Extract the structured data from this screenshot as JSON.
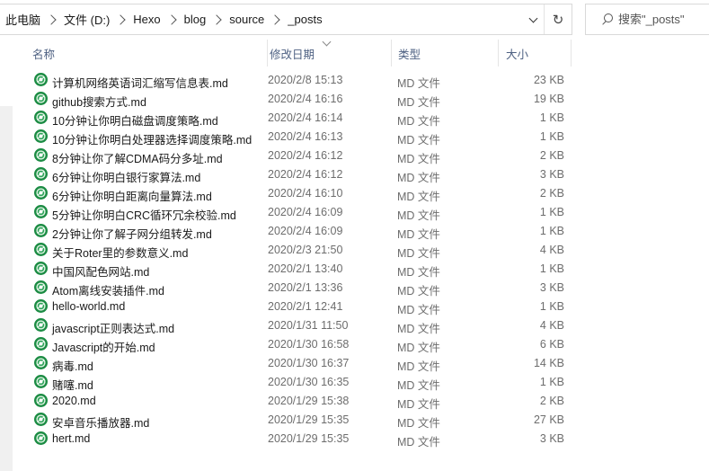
{
  "address": {
    "crumbs": [
      "此电脑",
      "文件 (D:)",
      "Hexo",
      "blog",
      "source",
      "_posts"
    ],
    "refresh_glyph": "↻"
  },
  "search": {
    "placeholder": "搜索\"_posts\""
  },
  "columns": {
    "name": "名称",
    "date": "修改日期",
    "type": "类型",
    "size": "大小"
  },
  "files": [
    {
      "name": "计算机网络英语词汇缩写信息表.md",
      "date": "2020/2/8 15:13",
      "type": "MD 文件",
      "size": "23 KB"
    },
    {
      "name": "github搜索方式.md",
      "date": "2020/2/4 16:16",
      "type": "MD 文件",
      "size": "19 KB"
    },
    {
      "name": "10分钟让你明白磁盘调度策略.md",
      "date": "2020/2/4 16:14",
      "type": "MD 文件",
      "size": "1 KB"
    },
    {
      "name": "10分钟让你明白处理器选择调度策略.md",
      "date": "2020/2/4 16:13",
      "type": "MD 文件",
      "size": "1 KB"
    },
    {
      "name": "8分钟让你了解CDMA码分多址.md",
      "date": "2020/2/4 16:12",
      "type": "MD 文件",
      "size": "2 KB"
    },
    {
      "name": "6分钟让你明白银行家算法.md",
      "date": "2020/2/4 16:12",
      "type": "MD 文件",
      "size": "3 KB"
    },
    {
      "name": "6分钟让你明白距离向量算法.md",
      "date": "2020/2/4 16:10",
      "type": "MD 文件",
      "size": "2 KB"
    },
    {
      "name": "5分钟让你明白CRC循环冗余校验.md",
      "date": "2020/2/4 16:09",
      "type": "MD 文件",
      "size": "1 KB"
    },
    {
      "name": "2分钟让你了解子网分组转发.md",
      "date": "2020/2/4 16:09",
      "type": "MD 文件",
      "size": "1 KB"
    },
    {
      "name": "关于Roter里的参数意义.md",
      "date": "2020/2/3 21:50",
      "type": "MD 文件",
      "size": "4 KB"
    },
    {
      "name": "中国风配色网站.md",
      "date": "2020/2/1 13:40",
      "type": "MD 文件",
      "size": "1 KB"
    },
    {
      "name": "Atom离线安装插件.md",
      "date": "2020/2/1 13:36",
      "type": "MD 文件",
      "size": "3 KB"
    },
    {
      "name": "hello-world.md",
      "date": "2020/2/1 12:41",
      "type": "MD 文件",
      "size": "1 KB"
    },
    {
      "name": "javascript正则表达式.md",
      "date": "2020/1/31 11:50",
      "type": "MD 文件",
      "size": "4 KB"
    },
    {
      "name": "Javascript的开始.md",
      "date": "2020/1/30 16:58",
      "type": "MD 文件",
      "size": "6 KB"
    },
    {
      "name": "病毒.md",
      "date": "2020/1/30 16:37",
      "type": "MD 文件",
      "size": "14 KB"
    },
    {
      "name": "赌噻.md",
      "date": "2020/1/30 16:35",
      "type": "MD 文件",
      "size": "1 KB"
    },
    {
      "name": "2020.md",
      "date": "2020/1/29 15:38",
      "type": "MD 文件",
      "size": "2 KB"
    },
    {
      "name": "安卓音乐播放器.md",
      "date": "2020/1/29 15:35",
      "type": "MD 文件",
      "size": "27 KB"
    },
    {
      "name": "hert.md",
      "date": "2020/1/29 15:35",
      "type": "MD 文件",
      "size": "3 KB"
    }
  ]
}
